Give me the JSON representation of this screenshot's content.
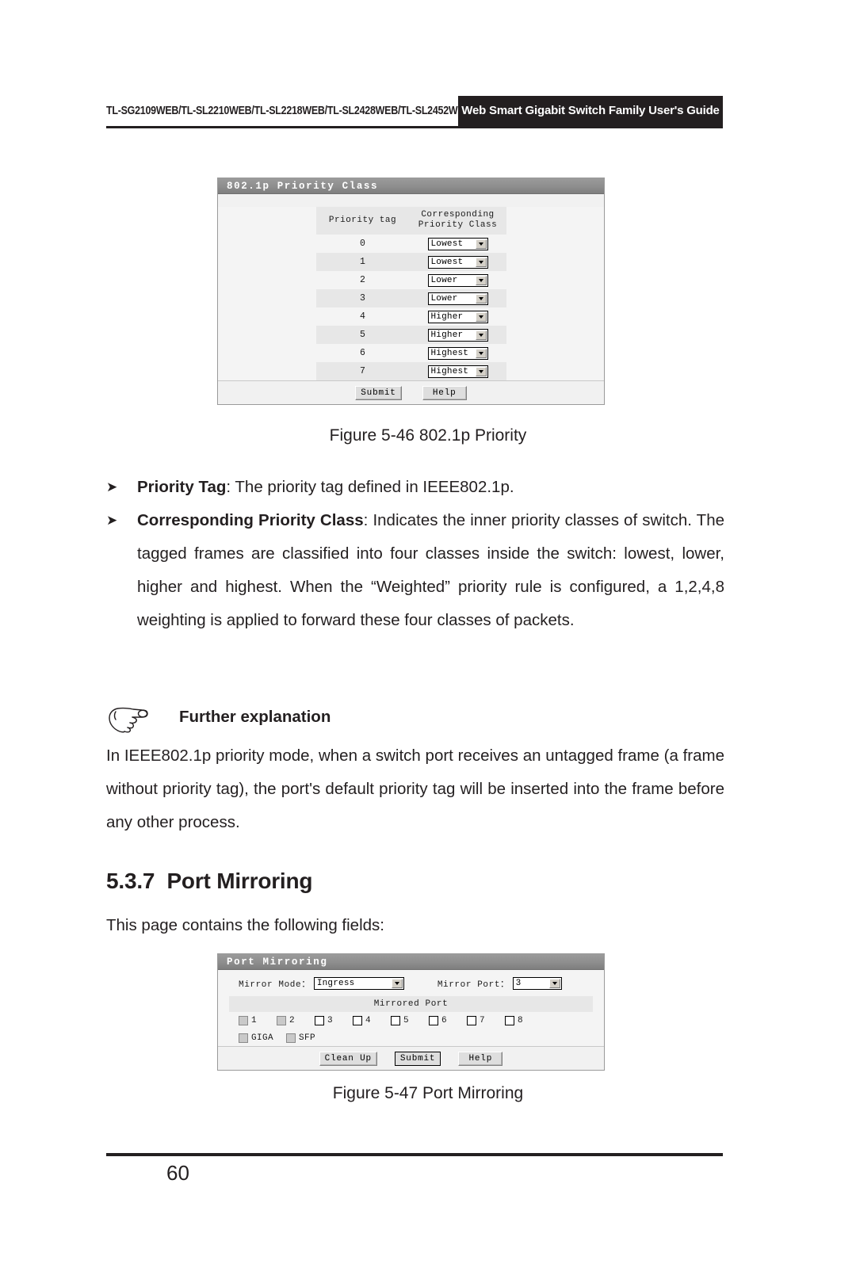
{
  "header": {
    "models": "TL-SG2109WEB/TL-SL2210WEB/TL-SL2218WEB/TL-SL2428WEB/TL-SL2452WEB",
    "guide_title": "Web Smart Gigabit Switch Family User's Guide"
  },
  "figure_546": {
    "panel_title": "802.1p Priority Class",
    "columns": {
      "priority_tag": "Priority tag",
      "corresponding_priority_class_line1": "Corresponding",
      "corresponding_priority_class_line2": "Priority Class"
    },
    "rows": [
      {
        "tag": "0",
        "priority_class": "Lowest"
      },
      {
        "tag": "1",
        "priority_class": "Lowest"
      },
      {
        "tag": "2",
        "priority_class": "Lower"
      },
      {
        "tag": "3",
        "priority_class": "Lower"
      },
      {
        "tag": "4",
        "priority_class": "Higher"
      },
      {
        "tag": "5",
        "priority_class": "Higher"
      },
      {
        "tag": "6",
        "priority_class": "Highest"
      },
      {
        "tag": "7",
        "priority_class": "Highest"
      }
    ],
    "buttons": {
      "submit": "Submit",
      "help": "Help"
    },
    "caption": "Figure 5-46  802.1p Priority"
  },
  "bullets": [
    {
      "marker": "➤",
      "term": "Priority Tag",
      "rest": ": The priority tag defined in IEEE802.1p."
    },
    {
      "marker": "➤",
      "term": "Corresponding Priority Class",
      "rest": ": Indicates the inner priority classes of switch. The tagged frames are classified into four classes inside the switch: lowest, lower, higher and highest. When the “Weighted” priority rule is configured, a 1,2,4,8 weighting is applied to forward these four classes of packets."
    }
  ],
  "note": {
    "title": "Further explanation",
    "body": "In IEEE802.1p priority mode, when a switch port receives an untagged frame (a frame without priority tag), the port's default priority tag will be inserted into the frame before any other process."
  },
  "section": {
    "number": "5.3.7",
    "title": "Port Mirroring",
    "intro": "This page contains the following fields:"
  },
  "figure_547": {
    "panel_title": "Port Mirroring",
    "fields": {
      "mirror_mode_label": "Mirror Mode：",
      "mirror_mode_value": "Ingress",
      "mirror_port_label": "Mirror Port：",
      "mirror_port_value": "3"
    },
    "mirrored_port_header": "Mirrored Port",
    "port_checkboxes": [
      {
        "label": "1",
        "checked": false,
        "disabled": true
      },
      {
        "label": "2",
        "checked": false,
        "disabled": true
      },
      {
        "label": "3",
        "checked": false,
        "disabled": false
      },
      {
        "label": "4",
        "checked": false,
        "disabled": false
      },
      {
        "label": "5",
        "checked": false,
        "disabled": false
      },
      {
        "label": "6",
        "checked": false,
        "disabled": false
      },
      {
        "label": "7",
        "checked": false,
        "disabled": false
      },
      {
        "label": "8",
        "checked": false,
        "disabled": false
      }
    ],
    "special_checkboxes": [
      {
        "label": "GIGA",
        "checked": false,
        "disabled": true
      },
      {
        "label": "SFP",
        "checked": false,
        "disabled": true
      }
    ],
    "buttons": {
      "clean_up": "Clean Up",
      "submit": "Submit",
      "help": "Help"
    },
    "caption": "Figure 5-47 Port Mirroring"
  },
  "footer": {
    "page_number": "60"
  },
  "colors": {
    "ink": "#231f20",
    "panel_title_bar": "#8e8e8e",
    "panel_body": "#f4f4f4",
    "row_alt": "#e7e7e7"
  }
}
